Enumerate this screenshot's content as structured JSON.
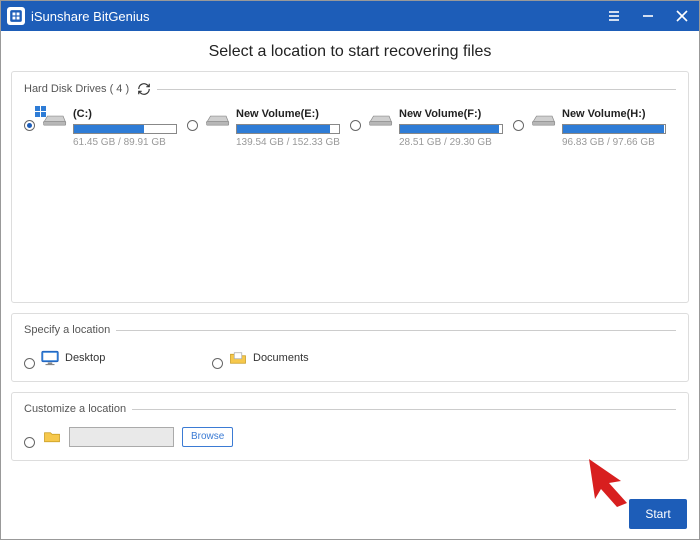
{
  "app": {
    "title": "iSunshare BitGenius"
  },
  "heading": "Select a location to start recovering files",
  "sections": {
    "hdd_label": "Hard Disk Drives ( 4 )",
    "specify_label": "Specify a location",
    "customize_label": "Customize a location"
  },
  "drives": [
    {
      "name": "(C:)",
      "used": 61.45,
      "total": 89.91,
      "sub": "61.45 GB / 89.91 GB",
      "selected": true,
      "os": true
    },
    {
      "name": "New Volume(E:)",
      "used": 139.54,
      "total": 152.33,
      "sub": "139.54 GB / 152.33 GB",
      "selected": false,
      "os": false
    },
    {
      "name": "New Volume(F:)",
      "used": 28.51,
      "total": 29.3,
      "sub": "28.51 GB / 29.30 GB",
      "selected": false,
      "os": false
    },
    {
      "name": "New Volume(H:)",
      "used": 96.83,
      "total": 97.66,
      "sub": "96.83 GB / 97.66 GB",
      "selected": false,
      "os": false
    }
  ],
  "locations": {
    "desktop": "Desktop",
    "documents": "Documents"
  },
  "buttons": {
    "browse": "Browse",
    "start": "Start"
  },
  "colors": {
    "accent": "#1d5db8",
    "bar_fill": "#2e7cd6"
  }
}
